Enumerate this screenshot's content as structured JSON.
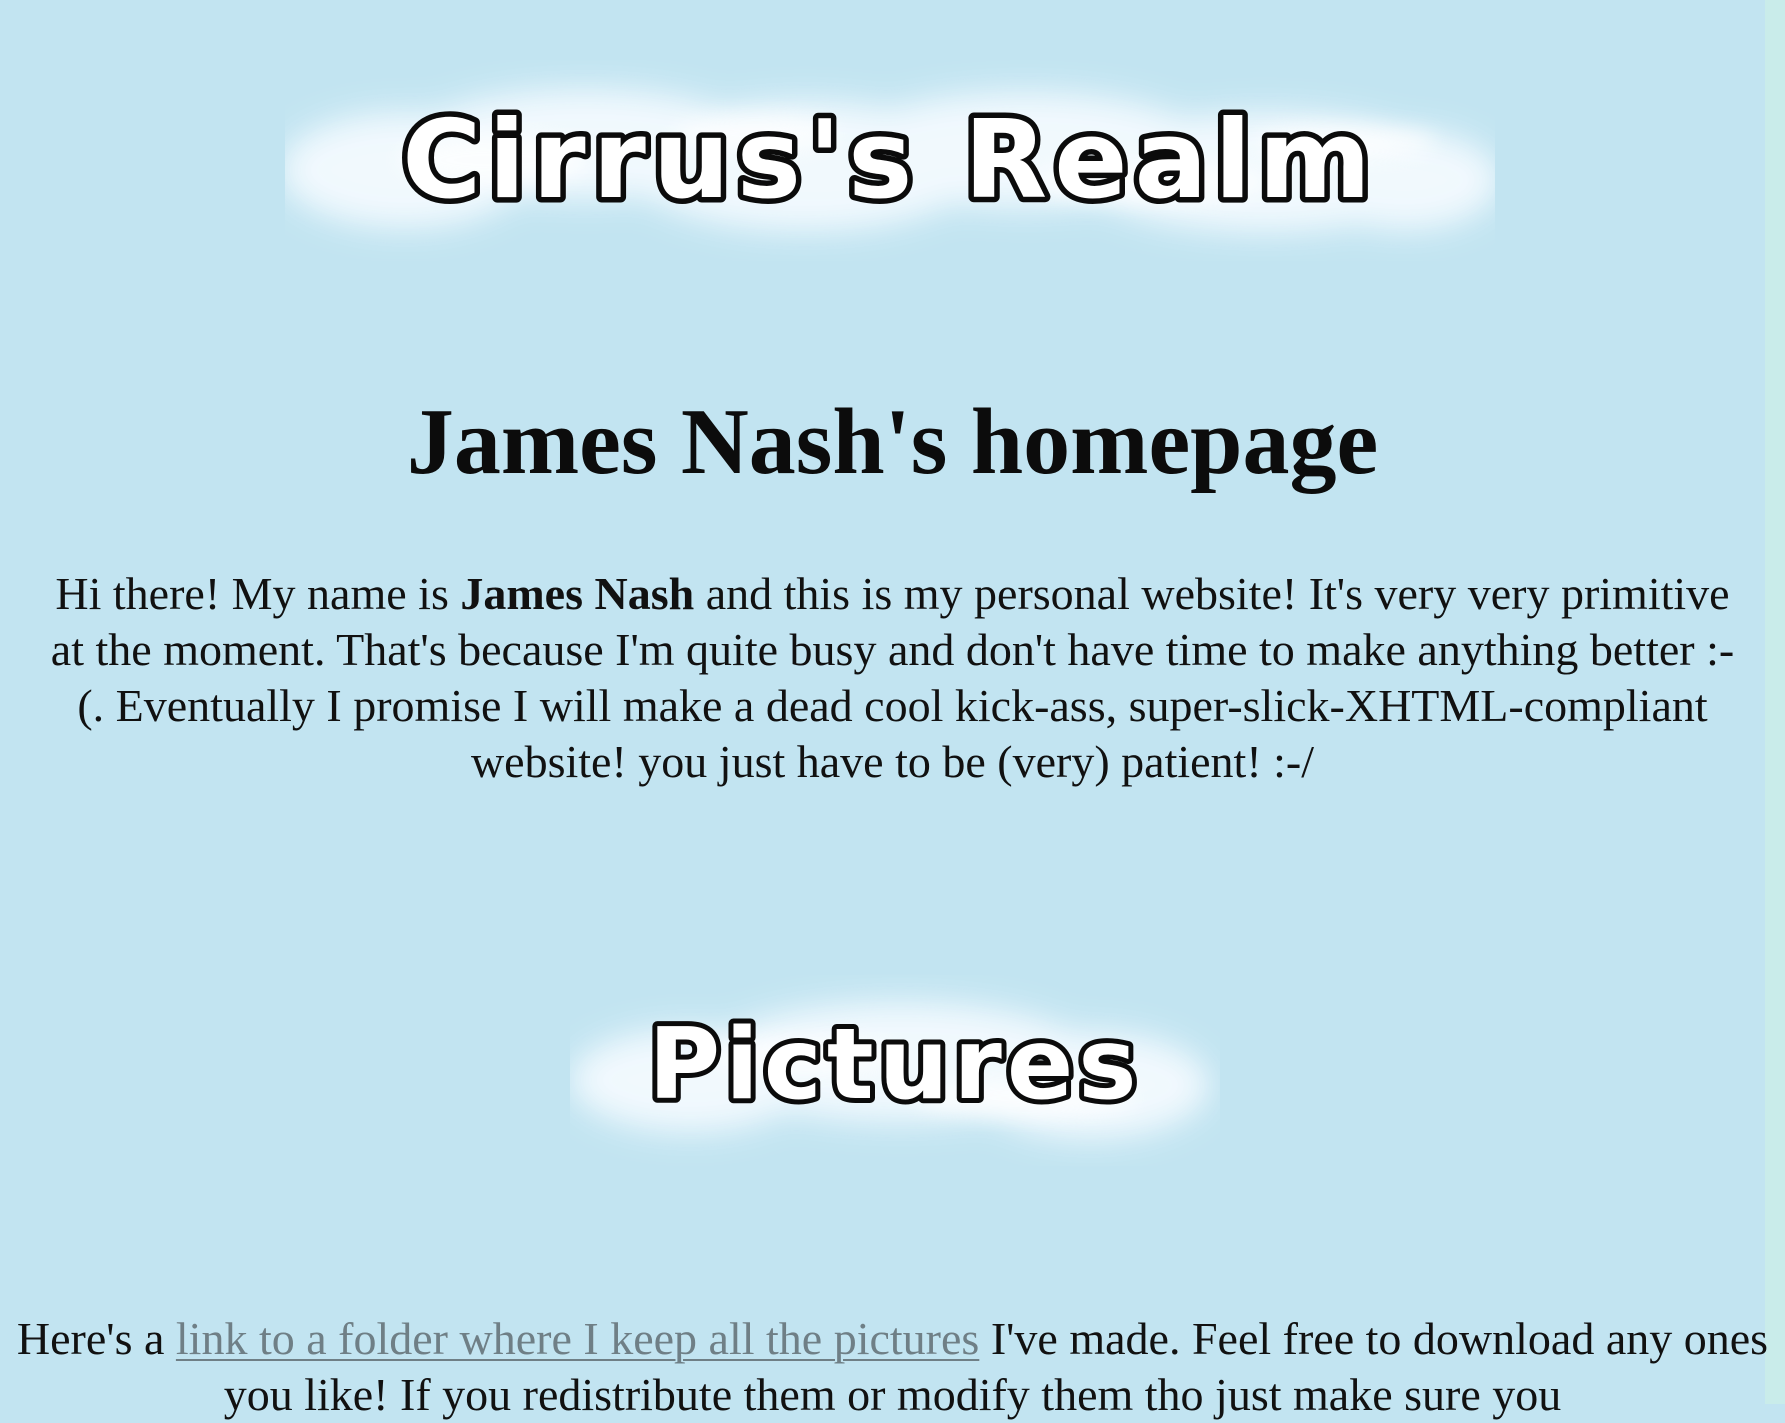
{
  "logo": {
    "text": "Cirrus's Realm"
  },
  "page": {
    "title": "James Nash's homepage"
  },
  "intro": {
    "part1": "Hi there! My name is ",
    "name": "James Nash",
    "part2": " and this is my personal website! It's very very primitive at the moment. That's because I'm quite busy and don't have time to make anything better :-(. Eventually I promise I will make a dead cool kick-ass, super-slick-XHTML-compliant website! you just have to be (very) patient! :-/"
  },
  "pictures": {
    "heading": "Pictures",
    "text_before": "Here's a ",
    "link": "link to a folder where I keep all the pictures",
    "text_after": " I've made. Feel free to download any ones you like! If you redistribute them or modify them tho just make sure you"
  },
  "colors": {
    "background": "#c2e4f1",
    "right_edge": "#c9ecea",
    "text": "#111111",
    "link": "#6f7f86",
    "logo_fill": "#ffffff",
    "logo_stroke": "#0b0b0b",
    "cloud": "#f5fbff"
  }
}
